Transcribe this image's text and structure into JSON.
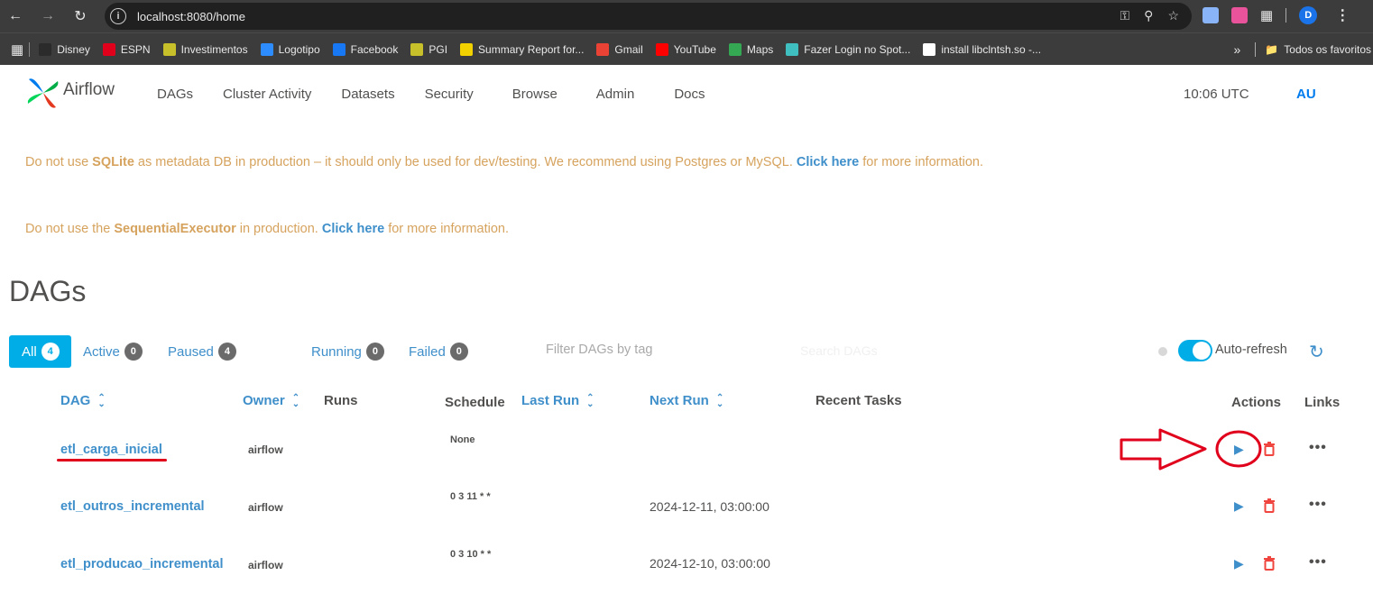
{
  "browser": {
    "url": "localhost:8080/home",
    "profile_initial": "D",
    "bookmarks": [
      {
        "label": "Disney",
        "color": "#2b2b2b"
      },
      {
        "label": "ESPN",
        "color": "#e0001b"
      },
      {
        "label": "Investimentos",
        "color": "#c7c02a"
      },
      {
        "label": "Logotipo",
        "color": "#2d8cff"
      },
      {
        "label": "Facebook",
        "color": "#1877f2"
      },
      {
        "label": "PGI",
        "color": "#c7c02a"
      },
      {
        "label": "Summary Report for...",
        "color": "#f2d100"
      },
      {
        "label": "Gmail",
        "color": "#ea4335"
      },
      {
        "label": "YouTube",
        "color": "#ff0000"
      },
      {
        "label": "Maps",
        "color": "#34a853"
      },
      {
        "label": "Fazer Login no Spot...",
        "color": "#3fbfbf"
      },
      {
        "label": "install libclntsh.so -...",
        "color": "#ffffff"
      }
    ],
    "all_bookmarks_label": "Todos os favoritos"
  },
  "airflow": {
    "logo_text": "Airflow",
    "menu": [
      "DAGs",
      "Cluster Activity",
      "Datasets",
      "Security",
      "Browse",
      "Admin",
      "Docs"
    ],
    "time": "10:06 UTC",
    "user": "AU"
  },
  "alerts": {
    "sqlite": {
      "pre": "Do not use ",
      "bold": "SQLite",
      "mid": " as metadata DB in production – it should only be used for dev/testing. We recommend using Postgres or MySQL. ",
      "link": "Click here",
      "post": " for more information."
    },
    "executor": {
      "pre": "Do not use the ",
      "bold": "SequentialExecutor",
      "mid": " in production. ",
      "link": "Click here",
      "post": " for more information."
    }
  },
  "page": {
    "title": "DAGs",
    "filters": {
      "all": {
        "label": "All",
        "count": "4"
      },
      "active": {
        "label": "Active",
        "count": "0"
      },
      "paused": {
        "label": "Paused",
        "count": "4"
      },
      "running": {
        "label": "Running",
        "count": "0"
      },
      "failed": {
        "label": "Failed",
        "count": "0"
      }
    },
    "tag_filter_placeholder": "Filter DAGs by tag",
    "search_placeholder": "Search DAGs",
    "auto_refresh_label": "Auto-refresh"
  },
  "table": {
    "headers": {
      "dag": "DAG",
      "owner": "Owner",
      "runs": "Runs",
      "schedule": "Schedule",
      "last_run": "Last Run",
      "next_run": "Next Run",
      "recent_tasks": "Recent Tasks",
      "actions": "Actions",
      "links": "Links"
    },
    "rows": [
      {
        "dag_id": "etl_carga_inicial",
        "owner": "airflow",
        "schedule": "None",
        "next_run": ""
      },
      {
        "dag_id": "etl_outros_incremental",
        "owner": "airflow",
        "schedule": "0 3 11 * *",
        "next_run": "2024-12-11, 03:00:00"
      },
      {
        "dag_id": "etl_producao_incremental",
        "owner": "airflow",
        "schedule": "0 3 10 * *",
        "next_run": "2024-12-10, 03:00:00"
      }
    ]
  },
  "colors": {
    "link_blue": "#3f8fca",
    "accent": "#00ade6",
    "warning_text": "#d6a35e",
    "delete_red": "#f0443e",
    "annotation_red": "#e0001b"
  }
}
